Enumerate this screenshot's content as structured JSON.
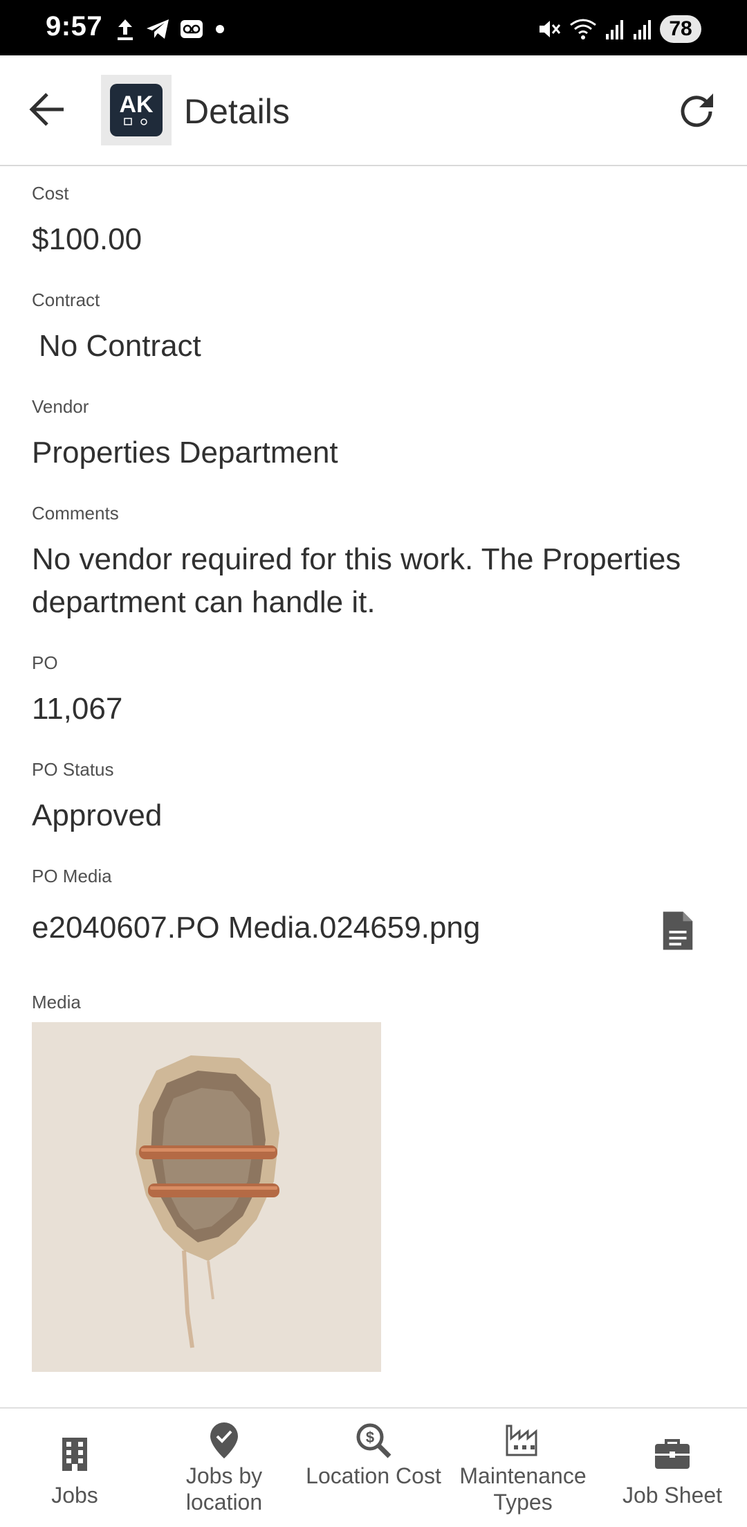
{
  "status_bar": {
    "time": "9:57",
    "battery": "78",
    "left_icons": [
      "upload-icon",
      "telegram-icon",
      "voicemail-icon",
      "dot-icon"
    ],
    "right_icons": [
      "mute-icon",
      "wifi-icon",
      "signal-icon",
      "signal-icon"
    ]
  },
  "app_bar": {
    "logo_text": "AK",
    "title": "Details"
  },
  "fields": {
    "cost": {
      "label": "Cost",
      "value": "$100.00"
    },
    "contract": {
      "label": "Contract",
      "value": "No Contract"
    },
    "vendor": {
      "label": "Vendor",
      "value": "Properties Department"
    },
    "comments": {
      "label": "Comments",
      "value": "No vendor required for this work.  The Properties department can handle it."
    },
    "po": {
      "label": "PO",
      "value": "11,067"
    },
    "po_status": {
      "label": "PO Status",
      "value": "Approved"
    },
    "po_media": {
      "label": "PO Media",
      "value": "e2040607.PO Media.024659.png"
    },
    "media": {
      "label": "Media"
    }
  },
  "bottom_nav": {
    "items": [
      {
        "label": "Jobs",
        "icon": "building-icon"
      },
      {
        "label": "Jobs by location",
        "icon": "location-check-icon"
      },
      {
        "label": "Location Cost",
        "icon": "dollar-search-icon"
      },
      {
        "label": "Maintenance Types",
        "icon": "factory-icon"
      },
      {
        "label": "Job Sheet",
        "icon": "briefcase-icon"
      }
    ]
  },
  "colors": {
    "text": "#303030",
    "label": "#505050",
    "icon": "#555555",
    "status_bar": "#000000"
  }
}
